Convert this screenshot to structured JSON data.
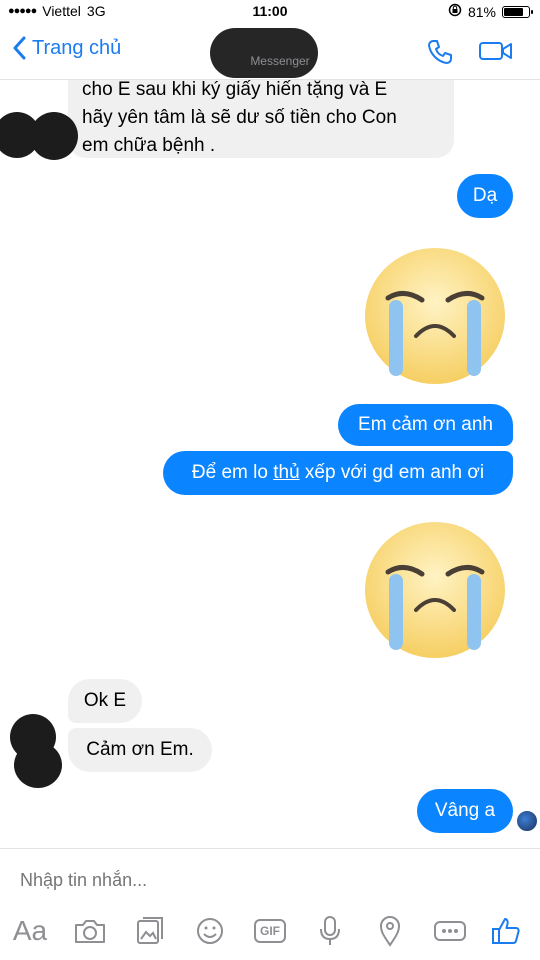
{
  "status": {
    "carrier": "Viettel",
    "network": "3G",
    "time": "11:00",
    "battery_text": "81%",
    "battery_level": 0.81
  },
  "nav": {
    "back_label": "Trang chủ",
    "subtitle": "Messenger"
  },
  "messages": {
    "top_in_lines": [
      "cho E sau khi ký giấy hiến tặng và E",
      "hãy yên tâm là sẽ dư số tiền cho Con",
      "em chữa bệnh ."
    ],
    "out_da": "Dạ",
    "out_thanks": "Em cảm ơn anh",
    "out_arrange_pre": "Để em lo ",
    "out_arrange_u": "thủ",
    "out_arrange_post": " xếp với gd em anh ơi",
    "in_ok": "Ok E",
    "in_thanks": "Cảm ơn Em.",
    "out_vang": "Vâng a"
  },
  "composer": {
    "placeholder": "Nhập tin nhắn..."
  },
  "toolbar": {
    "aa_label": "Aa",
    "gif_label": "GIF",
    "icons": [
      "text-format-icon",
      "camera-icon",
      "photo-icon",
      "emoji-icon",
      "gif-icon",
      "microphone-icon",
      "location-icon",
      "more-icon",
      "thumbs-up-icon"
    ]
  },
  "colors": {
    "accent": "#0a84ff",
    "incoming_bubble": "#f1f0f0",
    "link": "#1a7cf0"
  }
}
